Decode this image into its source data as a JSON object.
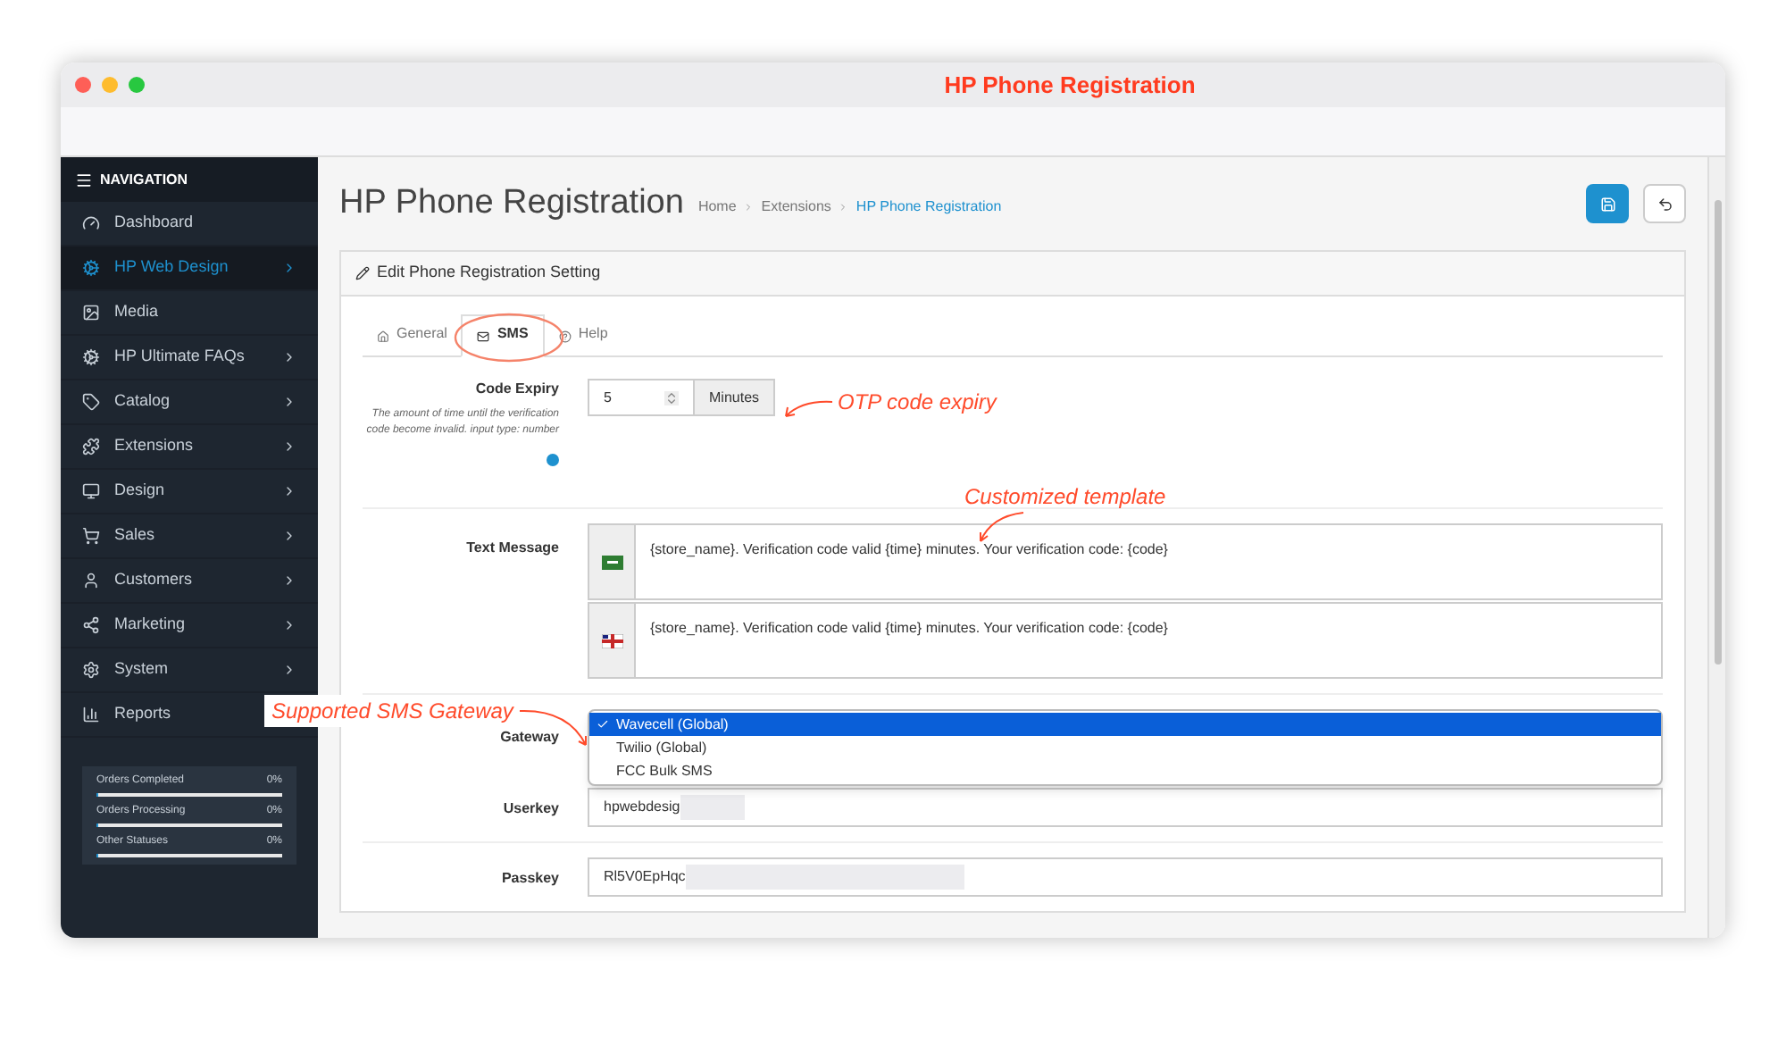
{
  "window": {
    "title": "HP Phone Registration"
  },
  "sidebar": {
    "heading": "NAVIGATION",
    "items": [
      {
        "label": "Dashboard",
        "selected": false,
        "expandable": false
      },
      {
        "label": "HP Web Design",
        "selected": true,
        "expandable": true
      },
      {
        "label": "Media",
        "selected": false,
        "expandable": false
      },
      {
        "label": "HP Ultimate FAQs",
        "selected": false,
        "expandable": true
      },
      {
        "label": "Catalog",
        "selected": false,
        "expandable": true
      },
      {
        "label": "Extensions",
        "selected": false,
        "expandable": true
      },
      {
        "label": "Design",
        "selected": false,
        "expandable": true
      },
      {
        "label": "Sales",
        "selected": false,
        "expandable": true
      },
      {
        "label": "Customers",
        "selected": false,
        "expandable": true
      },
      {
        "label": "Marketing",
        "selected": false,
        "expandable": true
      },
      {
        "label": "System",
        "selected": false,
        "expandable": true
      },
      {
        "label": "Reports",
        "selected": false,
        "expandable": false
      }
    ],
    "stats": [
      {
        "label": "Orders Completed",
        "value": "0%",
        "level": 0
      },
      {
        "label": "Orders Processing",
        "value": "0%",
        "level": 0
      },
      {
        "label": "Other Statuses",
        "value": "0%",
        "level": 0
      }
    ]
  },
  "page": {
    "title": "HP Phone Registration",
    "breadcrumbs": [
      {
        "label": "Home",
        "selected": false
      },
      {
        "label": "Extensions",
        "selected": false
      },
      {
        "label": "HP Phone Registration",
        "selected": true
      }
    ]
  },
  "panel": {
    "title": "Edit Phone Registration Setting",
    "tabs": [
      {
        "label": "General",
        "selected": false
      },
      {
        "label": "SMS",
        "selected": true
      },
      {
        "label": "Help",
        "selected": false
      }
    ],
    "code_expiry": {
      "label": "Code Expiry",
      "help": "The amount of time until the verification code become invalid. input type: number",
      "value": "5",
      "unit": "Minutes"
    },
    "text_message": {
      "label": "Text Message",
      "rows": [
        {
          "value": "{store_name}. Verification code valid {time} minutes. Your verification code:  {code}"
        },
        {
          "value": "{store_name}. Verification code valid {time} minutes. Your verification code:  {code}"
        }
      ]
    },
    "gateway": {
      "label": "Gateway",
      "options": [
        {
          "label": "Wavecell (Global)",
          "selected": true
        },
        {
          "label": "Twilio (Global)",
          "selected": false
        },
        {
          "label": "FCC Bulk SMS",
          "selected": false
        }
      ]
    },
    "userkey": {
      "label": "Userkey",
      "value": "hpwebdesig"
    },
    "passkey": {
      "label": "Passkey",
      "value": "Rl5V0EpHqc"
    }
  },
  "annotations": [
    "OTP code expiry",
    "Customized template",
    "Supported SMS Gateway"
  ]
}
